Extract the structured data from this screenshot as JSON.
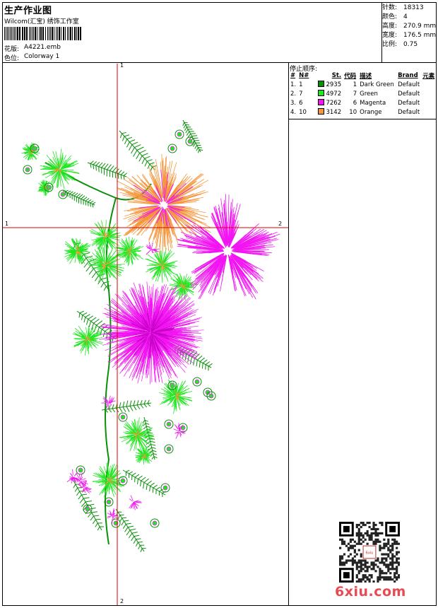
{
  "header": {
    "title": "生产作业图",
    "software": "Wilcom(汇宝) 绣饰工作室",
    "design_label": "花版:",
    "design_value": "A4221.emb",
    "colorway_label": "色位:",
    "colorway_value": "Colorway 1"
  },
  "stats": [
    {
      "label": "针数:",
      "value": "18313"
    },
    {
      "label": "颜色:",
      "value": "4"
    },
    {
      "label": "高度:",
      "value": "270.9 mm"
    },
    {
      "label": "宽度:",
      "value": "176.5 mm"
    },
    {
      "label": "比例:",
      "value": "0.75"
    }
  ],
  "stop_sequence": {
    "label": "停止顺序:",
    "columns": [
      "#",
      "N#",
      "St.",
      "代码",
      "描述",
      "Brand",
      "元素"
    ],
    "rows": [
      {
        "num": "1.",
        "n": "1",
        "color": "#0a8f0a",
        "st": "2935",
        "code": "1",
        "desc": "Dark Green",
        "brand": "Default"
      },
      {
        "num": "2.",
        "n": "7",
        "color": "#22e622",
        "st": "4972",
        "code": "7",
        "desc": "Green",
        "brand": "Default"
      },
      {
        "num": "3.",
        "n": "6",
        "color": "#f214f2",
        "st": "7262",
        "code": "6",
        "desc": "Magenta",
        "brand": "Default"
      },
      {
        "num": "4.",
        "n": "10",
        "color": "#f5963c",
        "st": "3142",
        "code": "10",
        "desc": "Orange",
        "brand": "Default"
      }
    ]
  },
  "axes": {
    "top": "1",
    "left": "1",
    "right": "2",
    "bottom": "2",
    "color": "#e00000"
  },
  "watermark": "6xiu.com",
  "qr_stamp": "6xiu"
}
